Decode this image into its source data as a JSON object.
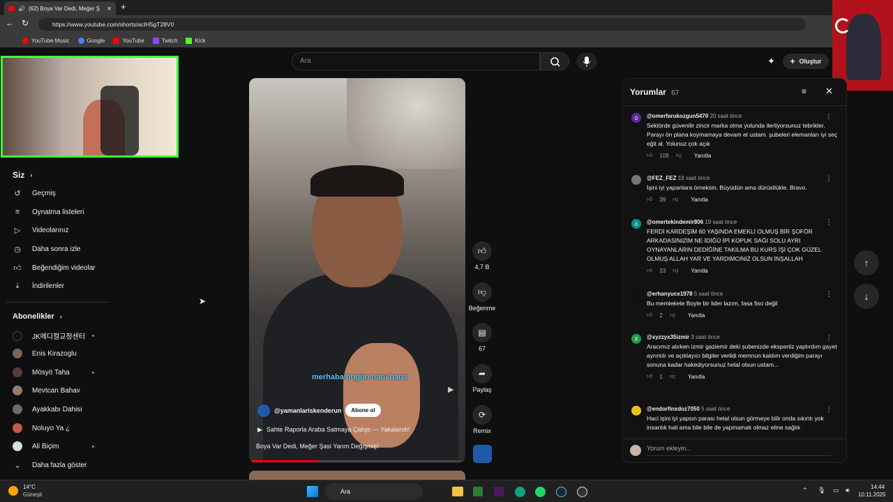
{
  "browser": {
    "tab_title": "(62) Boya Var Dedi, Meğer Ş",
    "url": "https://www.youtube.com/shorts/acIH5gT28V0",
    "bookmarks": [
      "YouTube Music",
      "Google",
      "YouTube",
      "Twitch",
      "Kick"
    ]
  },
  "header": {
    "search_placeholder": "Ara",
    "create_label": "Oluştur"
  },
  "sidebar": {
    "you_title": "Siz",
    "you_items": [
      "Geçmiş",
      "Oynatma listeleri",
      "Videolarınız",
      "Daha sonra izle",
      "Beğendiğim videolar",
      "İndirilenler"
    ],
    "subs_title": "Abonelikler",
    "subscriptions": [
      "JK메디컬교정센터",
      "Enis Kirazoglu",
      "Mösyö Taha",
      "Mevtcan Bahav",
      "Ayakkabı Dahisi",
      "Noluyo Ya ¿",
      "Ali Biçim"
    ],
    "show_more": "Daha fazla göster"
  },
  "video": {
    "caption": "merhaba bugün hani bana",
    "channel": "@yamanlariskenderun",
    "subscribe_label": "Abone ol",
    "linked_video": "Sahte Raporla Araba Satmaya Çalıştı — Yakalandı!",
    "title": "Boya Var Dedi, Meğer Şasi Yarım Değişmiş!"
  },
  "actions": {
    "like_count": "4,7 B",
    "dislike_label": "Beğenme",
    "comment_count": "67",
    "share_label": "Paylaş",
    "remix_label": "Remix"
  },
  "comments": {
    "title": "Yorumlar",
    "count": "67",
    "add_placeholder": "Yorum ekleyin...",
    "reply_label": "Yanıtla",
    "items": [
      {
        "avatar": "ö",
        "user": "@omerfarukozgun5470",
        "time": "20 saat önce",
        "text": "Sektörde güvenilir zincir marka olma yolunda ilerliyorsunuz tebrikler. Parayı ön plana koymamaya devam et ustam. şubeleri elemanları iyi seç eğit al. Yolunuz çok açık",
        "likes": "109"
      },
      {
        "avatar": "",
        "user": "@FEZ_FEZ",
        "time": "19 saat önce",
        "text": "İşini iyi yapanlara örneksin. Büyüdün ama dürüstlükle. Bravo.",
        "likes": "39"
      },
      {
        "avatar": "ö",
        "user": "@omertekindemir806",
        "time": "19 saat önce",
        "text": "FERDİ KARDEŞİM  60 YAŞINDA EMEKLİ OLMUŞ BİR ŞOFÖR ARKADASINIZIM  NE İDİĞÜ İPİ KOPUK SAĞI SOLU AYRI OYNAYANLARIN DEDİĞİNE TAKILMA  BU KURS İŞİ ÇOK GÜZEL OLMUŞ  ALLAH YAR VE YARDIMCINIZ OLSUN İNŞALLAH",
        "likes": "23"
      },
      {
        "avatar": "",
        "user": "@erhanyuce1978",
        "time": "5 saat önce",
        "text": "Bu memlekete Boyle bir lider lazım, fasa fiso değil",
        "likes": "2"
      },
      {
        "avatar": "X",
        "user": "@xyzzyx35izmir",
        "time": "3 saat önce",
        "text": "Aracımız alırken izmir gaziemir deki şubenizde ekspertiz yaptırdım gayet ayrıntılı ve açıklayıcı  bilgiler verildi memnun kaldım verdiğim parayı sonuna kadar hakediyorsunuz helal olsun ustam...",
        "likes": "1"
      },
      {
        "avatar": "",
        "user": "@endorfinxdoz7050",
        "time": "5 saat önce",
        "text": "Haci işini iyi yapsın parası helal olsun görmeye bilir onda sıkıntı yok insanlık hali ama bile bile de yapmamak olmaz eline sağlık",
        "likes": ""
      }
    ]
  },
  "taskbar": {
    "temp": "14°C",
    "weather": "Güneşli",
    "search": "Ara",
    "time": "14:44",
    "date": "10.11.2025"
  },
  "colors": {
    "accent": "#3ea6ff",
    "youtube_red": "#ff0000",
    "webcam_border": "#3cff3c"
  }
}
